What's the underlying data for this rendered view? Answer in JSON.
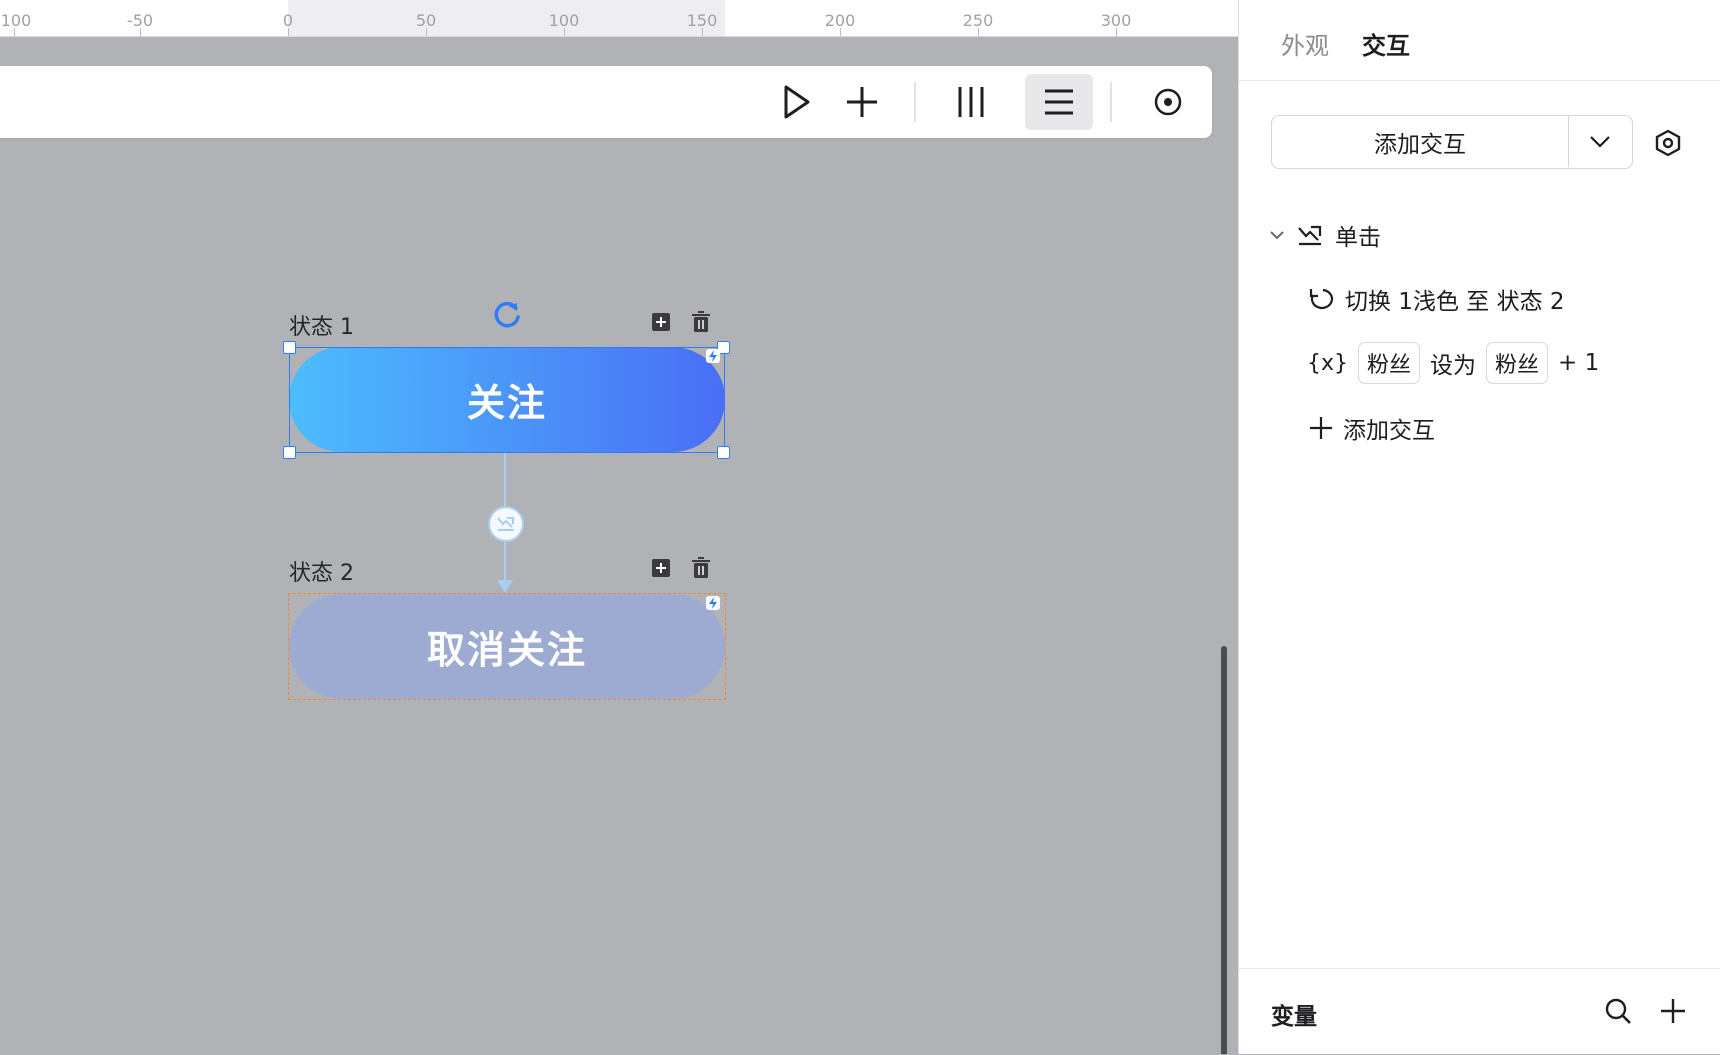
{
  "ruler": {
    "labels": [
      "100",
      "-50",
      "0",
      "50",
      "100",
      "150",
      "200",
      "250",
      "300"
    ]
  },
  "toolbar": {
    "buttons": [
      "play-icon",
      "plus-icon",
      "columns-icon",
      "list-icon",
      "record-icon"
    ],
    "active": "list-icon"
  },
  "states": [
    {
      "label": "状态 1",
      "button_text": "关注",
      "gradient": [
        "#4cbdfd",
        "#4a6ef5"
      ]
    },
    {
      "label": "状态 2",
      "button_text": "取消关注",
      "fill": "#9dabd3"
    }
  ],
  "panel": {
    "tabs": [
      {
        "label": "外观",
        "active": false
      },
      {
        "label": "交互",
        "active": true
      }
    ],
    "add_button": "添加交互",
    "trigger": {
      "label": "单击",
      "icon": "click-icon"
    },
    "actions": {
      "switch": "切换 1浅色 至 状态 2",
      "variable": {
        "target_chip": "粉丝",
        "set_to": "设为",
        "value_chip": "粉丝",
        "suffix": "+ 1"
      },
      "add": "添加交互"
    },
    "variables": {
      "title": "变量"
    }
  },
  "colors": {
    "accent": "#2f7df6",
    "selection_dashed": "#f08a36",
    "canvas": "#b1b2b6"
  }
}
